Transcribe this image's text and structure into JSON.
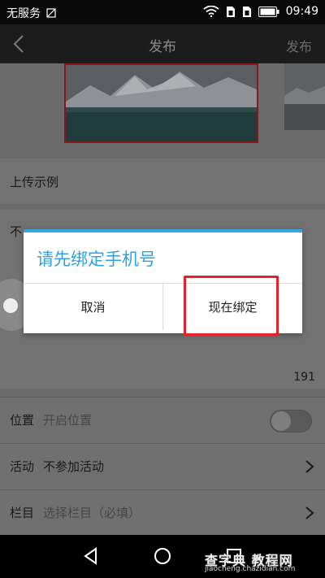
{
  "status_bar": {
    "carrier": "无服务",
    "time": "09:49"
  },
  "header": {
    "title": "发布",
    "publish_label": "发布"
  },
  "upload_section": {
    "label": "上传示例"
  },
  "text_section": {
    "partial_text": "不",
    "char_count": "191"
  },
  "dialog": {
    "title": "请先绑定手机号",
    "cancel_label": "取消",
    "confirm_label": "现在绑定",
    "accent_color": "#2fa1e0"
  },
  "rows": {
    "location": {
      "label": "位置",
      "value": "开启位置",
      "toggle_on": false
    },
    "activity": {
      "label": "活动",
      "value": "不参加活动"
    },
    "column": {
      "label": "栏目",
      "value": "选择栏目（必填）"
    }
  },
  "watermark": {
    "main": "查字典 教程网",
    "sub": "jiaocheng.chazidian.com"
  },
  "icons": {
    "back": "chevron-left-icon",
    "nav_back": "triangle-back-icon",
    "nav_home": "circle-home-icon",
    "nav_recent": "square-recent-icon"
  }
}
